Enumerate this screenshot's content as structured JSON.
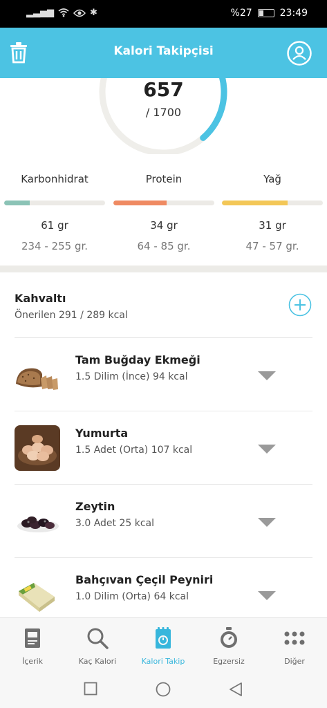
{
  "status_bar": {
    "battery_percent": "%27",
    "time": "23:49"
  },
  "header": {
    "title": "Kalori Takipçisi",
    "left_icon": "trash-icon",
    "right_icon": "profile-icon",
    "color": "#4cc3e3"
  },
  "summary": {
    "consumed": "657",
    "goal": "/ 1700",
    "progress_fraction": 0.386,
    "ring_color": "#4cc3e3"
  },
  "macros": [
    {
      "name": "Karbonhidrat",
      "amount": "61 gr",
      "range": "234 - 255 gr.",
      "fill_fraction": 0.25,
      "color": "#8bc3b6"
    },
    {
      "name": "Protein",
      "amount": "34 gr",
      "range": "64 - 85 gr.",
      "fill_fraction": 0.53,
      "color": "#ef8a62"
    },
    {
      "name": "Yağ",
      "amount": "31 gr",
      "range": "47 - 57 gr.",
      "fill_fraction": 0.65,
      "color": "#f3c757"
    }
  ],
  "meal": {
    "title": "Kahvaltı",
    "subtitle": "Önerilen 291 / 289 kcal",
    "items": [
      {
        "name": "Tam Buğday Ekmeği",
        "detail": "1.5 Dilim (İnce) 94 kcal",
        "image": "bread"
      },
      {
        "name": "Yumurta",
        "detail": "1.5 Adet (Orta) 107 kcal",
        "image": "eggs"
      },
      {
        "name": "Zeytin",
        "detail": "3.0 Adet 25 kcal",
        "image": "olives"
      },
      {
        "name": "Bahçıvan Çeçil Peyniri",
        "detail": "1.0 Dilim (Orta) 64 kcal",
        "image": "cheese"
      }
    ]
  },
  "bottom_nav": {
    "items": [
      {
        "label": "İçerik",
        "icon": "book-icon",
        "active": false
      },
      {
        "label": "Kaç Kalori",
        "icon": "search-icon",
        "active": false
      },
      {
        "label": "Kalori Takip",
        "icon": "tracker-icon",
        "active": true
      },
      {
        "label": "Egzersiz",
        "icon": "stopwatch-icon",
        "active": false
      },
      {
        "label": "Diğer",
        "icon": "more-icon",
        "active": false
      }
    ],
    "active_color": "#37b6dc"
  }
}
